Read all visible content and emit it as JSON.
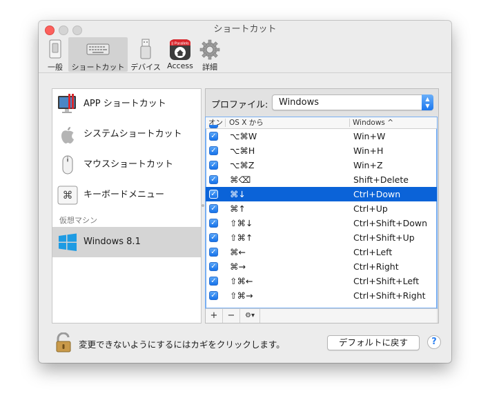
{
  "window": {
    "title": "ショートカット"
  },
  "toolbar": {
    "tabs": [
      {
        "label": "一般",
        "icon": "switch-icon",
        "selected": false
      },
      {
        "label": "ショートカット",
        "icon": "keyboard-icon",
        "selected": true
      },
      {
        "label": "デバイス",
        "icon": "usb-icon",
        "selected": false
      },
      {
        "label": "Access",
        "icon": "parallels-access-icon",
        "selected": false
      },
      {
        "label": "詳細",
        "icon": "gear-icon",
        "selected": false
      }
    ],
    "access_badge": "|| Parallels"
  },
  "sidebar": {
    "items": [
      {
        "label": "APP ショートカット",
        "icon": "app-shortcut-icon"
      },
      {
        "label": "システムショートカット",
        "icon": "apple-icon"
      },
      {
        "label": "マウスショートカット",
        "icon": "mouse-icon"
      },
      {
        "label": "キーボードメニュー",
        "icon": "command-key-icon",
        "glyph": "⌘"
      }
    ],
    "group_label": "仮想マシン",
    "vm_item": {
      "label": "Windows 8.1",
      "icon": "windows-logo-icon",
      "selected": true
    }
  },
  "profile": {
    "label": "プロファイル:",
    "value": "Windows"
  },
  "table": {
    "headers": {
      "on": "オン",
      "osx": "OS X から",
      "windows": "Windows",
      "sort_indicator": "^"
    },
    "rows": [
      {
        "checked": true,
        "osx": "⌥⌘W",
        "windows": "Win+W",
        "selected": false
      },
      {
        "checked": true,
        "osx": "⌥⌘H",
        "windows": "Win+H",
        "selected": false
      },
      {
        "checked": true,
        "osx": "⌥⌘Z",
        "windows": "Win+Z",
        "selected": false
      },
      {
        "checked": true,
        "osx": "⌘⌫",
        "windows": "Shift+Delete",
        "selected": false
      },
      {
        "checked": true,
        "osx": "⌘↓",
        "windows": "Ctrl+Down",
        "selected": true
      },
      {
        "checked": true,
        "osx": "⌘↑",
        "windows": "Ctrl+Up",
        "selected": false
      },
      {
        "checked": true,
        "osx": "⇧⌘↓",
        "windows": "Ctrl+Shift+Down",
        "selected": false
      },
      {
        "checked": true,
        "osx": "⇧⌘↑",
        "windows": "Ctrl+Shift+Up",
        "selected": false
      },
      {
        "checked": true,
        "osx": "⌘←",
        "windows": "Ctrl+Left",
        "selected": false
      },
      {
        "checked": true,
        "osx": "⌘→",
        "windows": "Ctrl+Right",
        "selected": false
      },
      {
        "checked": true,
        "osx": "⇧⌘←",
        "windows": "Ctrl+Shift+Left",
        "selected": false
      },
      {
        "checked": true,
        "osx": "⇧⌘→",
        "windows": "Ctrl+Shift+Right",
        "selected": false
      }
    ],
    "bottom_buttons": {
      "add": "+",
      "remove": "−",
      "action": "⚙▾"
    }
  },
  "footer": {
    "lock_text": "変更できないようにするにはカギをクリックします。",
    "default_button": "デフォルトに戻す",
    "help_button": "?"
  }
}
